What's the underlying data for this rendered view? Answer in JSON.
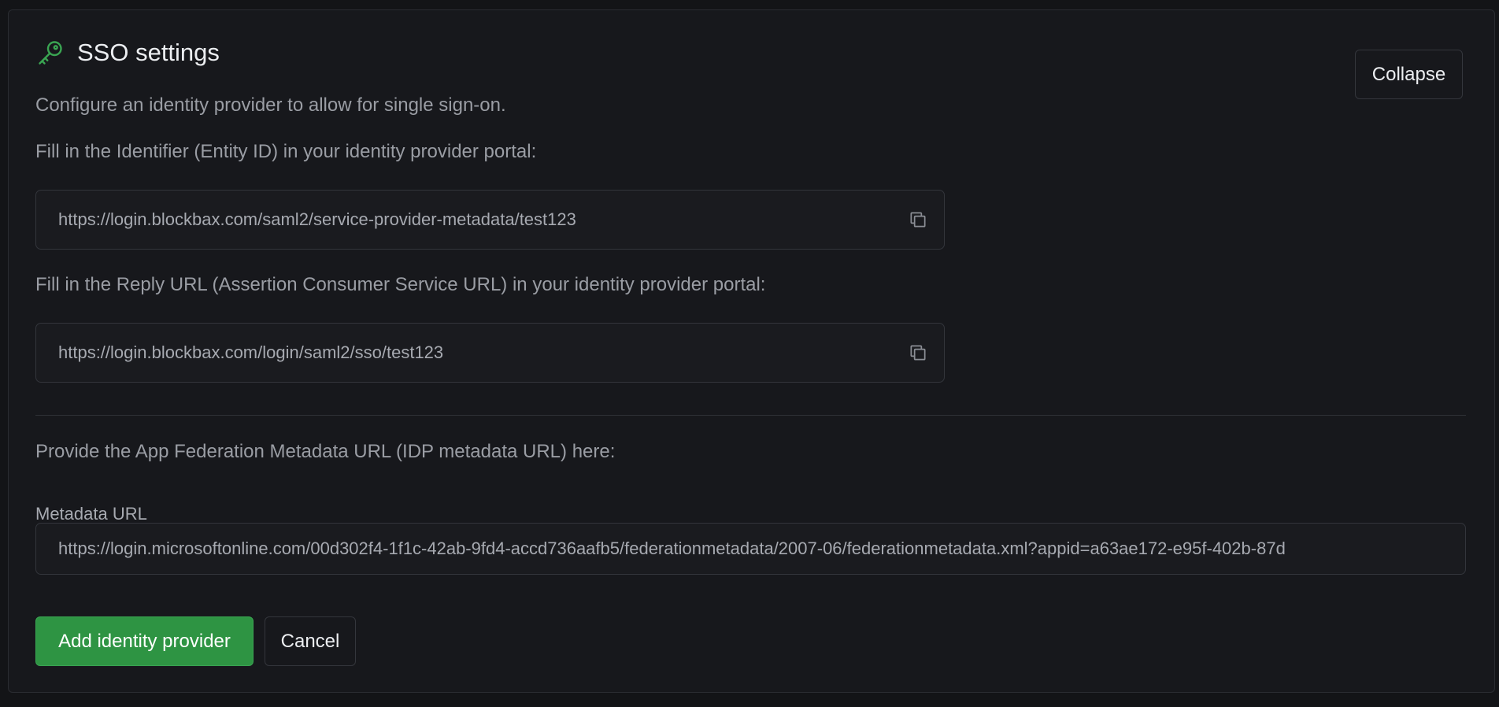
{
  "header": {
    "title": "SSO settings",
    "icon": "key-icon",
    "description": "Configure an identity provider to allow for single sign-on.",
    "collapse_label": "Collapse"
  },
  "entity_id": {
    "instruction": "Fill in the Identifier (Entity ID) in your identity provider portal:",
    "value": "https://login.blockbax.com/saml2/service-provider-metadata/test123",
    "icon": "copy-icon"
  },
  "reply_url": {
    "instruction": "Fill in the Reply URL (Assertion Consumer Service URL) in your identity provider portal:",
    "value": "https://login.blockbax.com/login/saml2/sso/test123",
    "icon": "copy-icon"
  },
  "metadata": {
    "instruction": "Provide the App Federation Metadata URL (IDP metadata URL) here:",
    "label": "Metadata URL",
    "value": "https://login.microsoftonline.com/00d302f4-1f1c-42ab-9fd4-accd736aafb5/federationmetadata/2007-06/federationmetadata.xml?appid=a63ae172-e95f-402b-87d"
  },
  "actions": {
    "add_label": "Add identity provider",
    "cancel_label": "Cancel"
  },
  "colors": {
    "accent": "#2e9443",
    "icon_green": "#3aa552",
    "background": "#17181c"
  }
}
